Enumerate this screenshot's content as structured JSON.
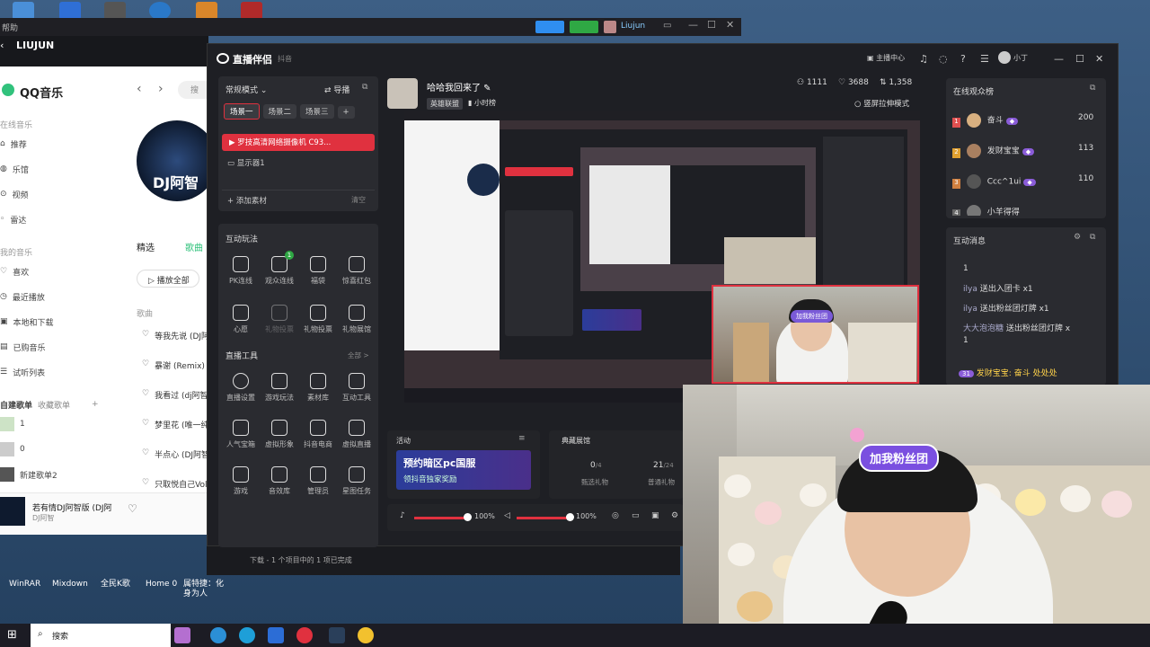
{
  "desktop": {
    "top_icons": [
      "#4a8fd8",
      "#2f6fd6",
      "#555",
      "#2a78c8",
      "#d9862a",
      "#b02a2a"
    ],
    "bottom_labels": [
      "WinRAR",
      "Mixdown",
      "全民K歌",
      "Home 0",
      "属特捷：化身为人"
    ]
  },
  "qq": {
    "top_window_title": "帮助",
    "header_name": "LIUJUN",
    "app_title": "QQ音乐",
    "search_placeholder": "搜",
    "nav_section_online": "在线音乐",
    "nav_online": [
      "推荐",
      "乐馆",
      "视频",
      "雷达"
    ],
    "nav_section_mine": "我的音乐",
    "nav_mine": [
      "喜欢",
      "最近播放",
      "本地和下载",
      "已购音乐",
      "试听列表"
    ],
    "playlist_tabs": [
      "自建歌单",
      "收藏歌单"
    ],
    "playlists": [
      "1",
      "0",
      "新建歌单2"
    ],
    "album_text": "DJ阿智",
    "tabs": [
      "精选",
      "歌曲"
    ],
    "play_all": "播放全部",
    "song_header": "歌曲",
    "songs": [
      "等我先说 (DJ阿",
      "暴谢 (Remix) (D",
      "我看过 (dj阿智",
      "梦里花 (唯一纯",
      "半点心 (DJ阿智",
      "只取悦自己Vol"
    ],
    "now_playing_title": "若有情DJ阿智版 (DJ阿",
    "now_playing_artist": "DJ阿智",
    "status_bar": "下载 - 1 个项目中的 1 项已完成"
  },
  "top_tray": {
    "user": "Liujun"
  },
  "companion": {
    "app_name": "直播伴侣",
    "platform": "抖音",
    "mode": "常规模式",
    "import": "导播",
    "scenes": [
      "场景一",
      "场景二",
      "场景三"
    ],
    "source_camera": "罗技高清网络摄像机 C93...",
    "source_display": "显示器1",
    "add_material": "添加素材",
    "clear": "清空",
    "interact_title": "互动玩法",
    "interact_tools": [
      "PK连线",
      "观众连线",
      "福袋",
      "惊喜红包",
      "心愿",
      "礼物投票",
      "礼物投票",
      "礼物展馆"
    ],
    "interact_badge": "1",
    "live_tools_title": "直播工具",
    "live_tools_all": "全部 >",
    "live_tools": [
      "直播设置",
      "游戏玩法",
      "素材库",
      "互动工具",
      "人气宝箱",
      "虚拟形象",
      "抖音电商",
      "虚拟直播",
      "游戏",
      "音效库",
      "管理员",
      "星图任务"
    ],
    "header_links": [
      "主播中心"
    ],
    "host_name": "小丁",
    "stream_title": "哈哈我回来了",
    "tag1": "英雄联盟",
    "tag2": "小时榜",
    "stat_viewers": "1111",
    "stat_likes": "3688",
    "stat_other": "1,358",
    "stretch_mode": "竖屏拉伸模式",
    "activity_title": "活动",
    "banner_line1": "预约暗区pc国服",
    "banner_line2": "领抖音独家奖励",
    "gift_title": "典藏展馆",
    "gift_count1": "0",
    "gift_total1": "/4",
    "gift_label1": "甄选礼物",
    "gift_count2": "21",
    "gift_total2": "/24",
    "gift_label2": "普通礼物",
    "mic_volume": "100%",
    "speaker_volume": "100%",
    "viewers_title": "在线观众榜",
    "viewers": [
      {
        "rank": "1",
        "name": "奋斗",
        "score": "200",
        "color": "#e05050"
      },
      {
        "rank": "2",
        "name": "发财宝宝",
        "score": "113",
        "color": "#e0a030"
      },
      {
        "rank": "3",
        "name": "Ccc^1ui",
        "score": "110",
        "color": "#d08040"
      },
      {
        "rank": "4",
        "name": "小羊得得",
        "score": "110",
        "color": "#888"
      }
    ],
    "messages_title": "互动消息",
    "messages": [
      {
        "user": "",
        "text": "1"
      },
      {
        "user": "ilya",
        "text": "送出入团卡  x1"
      },
      {
        "user": "ilya",
        "text": "送出粉丝团灯牌  x1"
      },
      {
        "user": "大大泡泡糖",
        "text": "送出粉丝团灯牌  x"
      },
      {
        "user": "",
        "text": "1"
      }
    ],
    "bottom_message_user": "发财宝宝:",
    "bottom_message_text": "奋斗 处处处",
    "bottom_message_badge": "31"
  },
  "camera": {
    "join_label": "加我粉丝团",
    "join_label_small": "加我粉丝团"
  },
  "taskbar": {
    "search": "搜索"
  }
}
